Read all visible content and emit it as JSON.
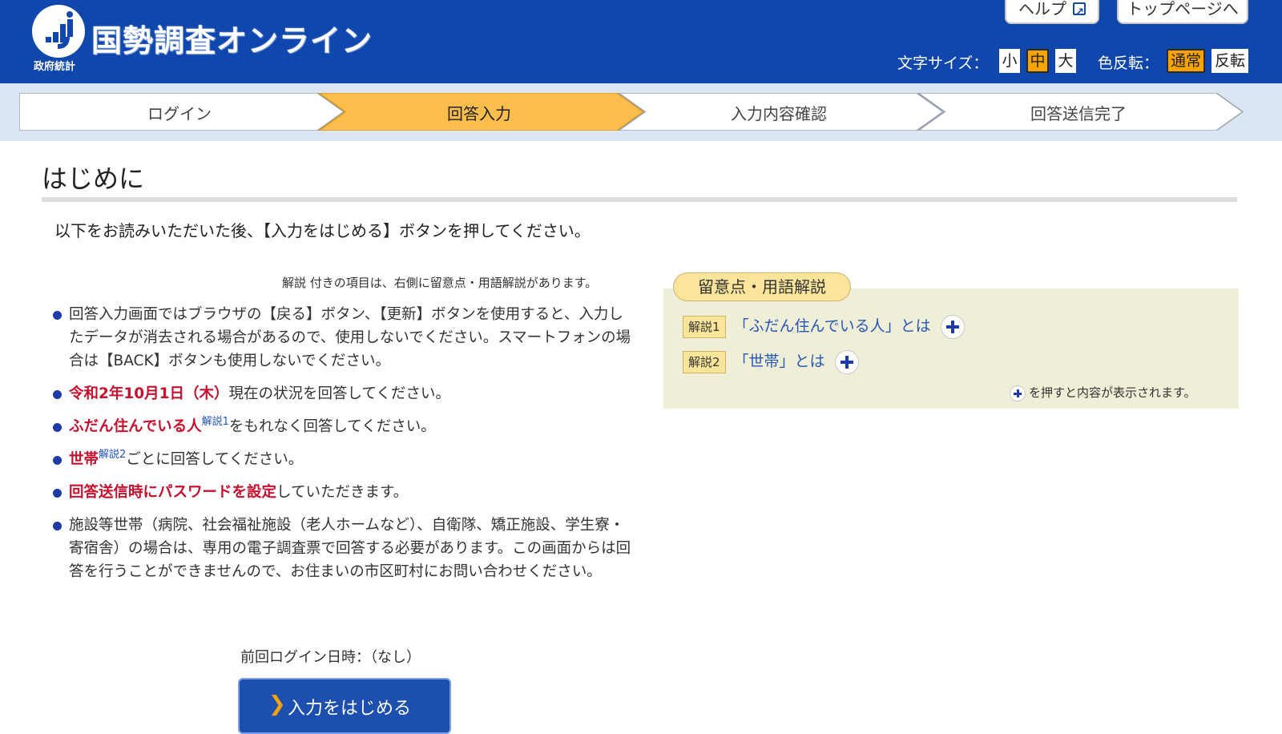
{
  "header": {
    "title": "国勢調査オンライン",
    "subtitle": "政府統計",
    "help_label": "ヘルプ",
    "top_label": "トップページへ",
    "font_size_label": "文字サイズ：",
    "font_sizes": [
      "小",
      "中",
      "大"
    ],
    "font_size_selected": "中",
    "color_label": "色反転：",
    "color_modes": [
      "通常",
      "反転"
    ],
    "color_mode_selected": "通常",
    "colors": {
      "brand": "#0f47ad",
      "accent": "#f7a300"
    }
  },
  "steps": {
    "items": [
      "ログイン",
      "回答入力",
      "入力内容確認",
      "回答送信完了"
    ],
    "current": "回答入力"
  },
  "main": {
    "title": "はじめに",
    "intro": "以下をお読みいただいた後、【入力をはじめる】ボタンを押してください。",
    "note": "解説 付きの項目は、右側に留意点・用語解説があります。",
    "bullets": {
      "b1": "回答入力画面ではブラウザの【戻る】ボタン、【更新】ボタンを使用すると、入力したデータが消去される場合があるので、使用しないでください。スマートフォンの場合は【BACK】ボタンも使用しないでください。",
      "b2_em": "令和2年10月1日（木）",
      "b2_rest": "現在の状況を回答してください。",
      "b3_em": "ふだん住んでいる人",
      "b3_sup": "解説1",
      "b3_rest": "をもれなく回答してください。",
      "b4_em": "世帯",
      "b4_sup": "解説2",
      "b4_rest": "ごとに回答してください。",
      "b5_em": "回答送信時にパスワードを設定",
      "b5_rest": "していただきます。",
      "b6": "施設等世帯（病院、社会福祉施設（老人ホームなど）、自衛隊、矯正施設、学生寮・寄宿舎）の場合は、専用の電子調査票で回答する必要があります。この画面からは回答を行うことができませんので、お住まいの市区町村にお問い合わせください。"
    },
    "last_login": "前回ログイン日時：（なし）",
    "start_button": "入力をはじめる"
  },
  "glossary": {
    "tab": "留意点・用語解説",
    "items": [
      {
        "tag": "解説1",
        "text": "「ふだん住んでいる人」とは"
      },
      {
        "tag": "解説2",
        "text": "「世帯」とは"
      }
    ],
    "note": "を押すと内容が表示されます。"
  }
}
